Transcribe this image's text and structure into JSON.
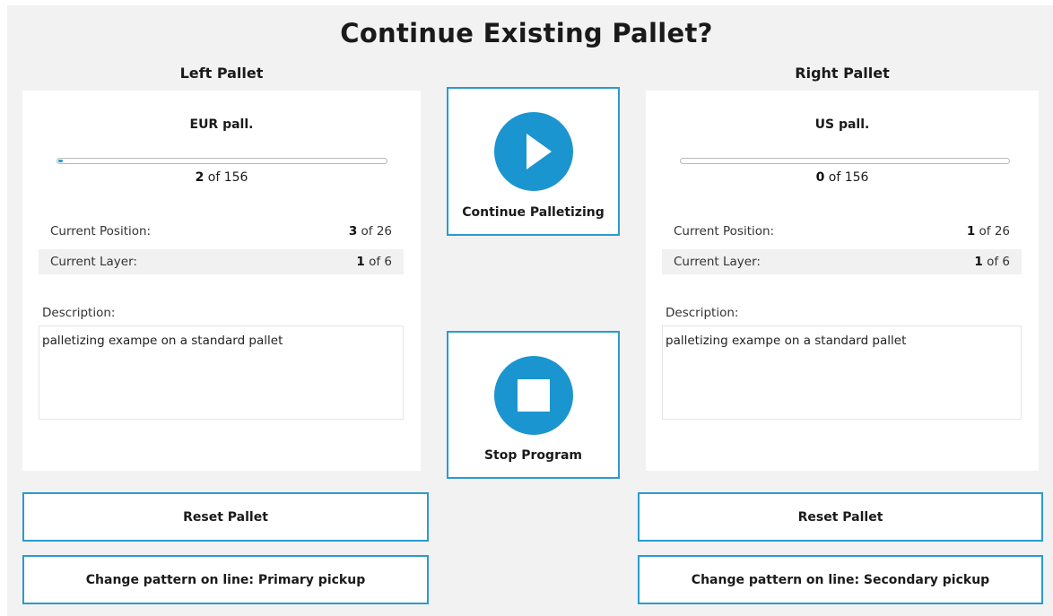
{
  "title": "Continue Existing Pallet?",
  "accent_color": "#1b95cf",
  "left": {
    "heading": "Left Pallet",
    "pallet_name": "EUR pall.",
    "progress": {
      "current": "2",
      "of_text": " of 156",
      "fraction": 0.0128
    },
    "position": {
      "label": "Current Position:",
      "current": "3",
      "of_text": " of 26"
    },
    "layer": {
      "label": "Current Layer:",
      "current": "1",
      "of_text": " of 6"
    },
    "description_label": "Description:",
    "description": "palletizing exampe on a standard pallet",
    "reset_label": "Reset Pallet",
    "change_pattern_label": "Change pattern on line: Primary pickup"
  },
  "right": {
    "heading": "Right Pallet",
    "pallet_name": "US pall.",
    "progress": {
      "current": "0",
      "of_text": " of 156",
      "fraction": 0
    },
    "position": {
      "label": "Current Position:",
      "current": "1",
      "of_text": " of 26"
    },
    "layer": {
      "label": "Current Layer:",
      "current": "1",
      "of_text": " of 6"
    },
    "description_label": "Description:",
    "description": "palletizing exampe on a standard pallet",
    "reset_label": "Reset Pallet",
    "change_pattern_label": "Change pattern on line: Secondary pickup"
  },
  "actions": {
    "continue": {
      "label": "Continue Palletizing",
      "icon": "play-icon"
    },
    "stop": {
      "label": "Stop Program",
      "icon": "stop-icon"
    }
  }
}
